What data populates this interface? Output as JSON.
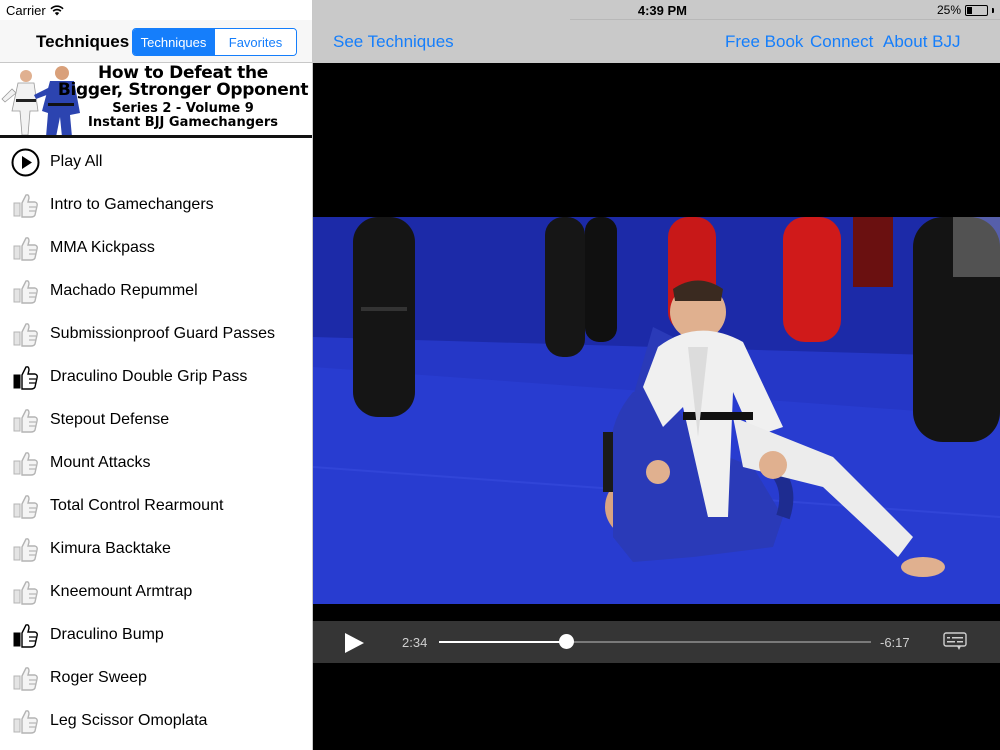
{
  "status_bar": {
    "carrier": "Carrier",
    "time": "4:39 PM",
    "battery": "25%",
    "battery_level": 0.25
  },
  "sidebar": {
    "title": "Techniques",
    "segments": [
      {
        "label": "Techniques",
        "active": true
      },
      {
        "label": "Favorites",
        "active": false
      }
    ],
    "banner": {
      "line1": "How to Defeat the",
      "line2": "Bigger, Stronger Opponent",
      "line3": "Series 2 - Volume 9",
      "line4": "Instant BJJ Gamechangers"
    },
    "items": [
      {
        "label": "Play All",
        "icon": "play-circle-icon"
      },
      {
        "label": "Intro to Gamechangers",
        "icon": "thumbs-up-icon",
        "favorite": false
      },
      {
        "label": "MMA Kickpass",
        "icon": "thumbs-up-icon",
        "favorite": false
      },
      {
        "label": "Machado Repummel",
        "icon": "thumbs-up-icon",
        "favorite": false
      },
      {
        "label": "Submissionproof Guard Passes",
        "icon": "thumbs-up-icon",
        "favorite": false
      },
      {
        "label": "Draculino Double Grip Pass",
        "icon": "thumbs-up-icon",
        "favorite": true
      },
      {
        "label": "Stepout Defense",
        "icon": "thumbs-up-icon",
        "favorite": false
      },
      {
        "label": "Mount Attacks",
        "icon": "thumbs-up-icon",
        "favorite": false
      },
      {
        "label": "Total Control Rearmount",
        "icon": "thumbs-up-icon",
        "favorite": false
      },
      {
        "label": "Kimura Backtake",
        "icon": "thumbs-up-icon",
        "favorite": false
      },
      {
        "label": "Kneemount Armtrap",
        "icon": "thumbs-up-icon",
        "favorite": false
      },
      {
        "label": "Draculino Bump",
        "icon": "thumbs-up-icon",
        "favorite": true
      },
      {
        "label": "Roger Sweep",
        "icon": "thumbs-up-icon",
        "favorite": false
      },
      {
        "label": "Leg Scissor Omoplata",
        "icon": "thumbs-up-icon",
        "favorite": false
      }
    ]
  },
  "header": {
    "see_techniques": "See Techniques",
    "links": [
      "Free Book",
      "Connect",
      "About BJJ"
    ]
  },
  "player": {
    "elapsed": "2:34",
    "remaining": "-6:17",
    "progress": 0.295,
    "play_icon": "play-icon",
    "captions_icon": "captions-icon"
  }
}
